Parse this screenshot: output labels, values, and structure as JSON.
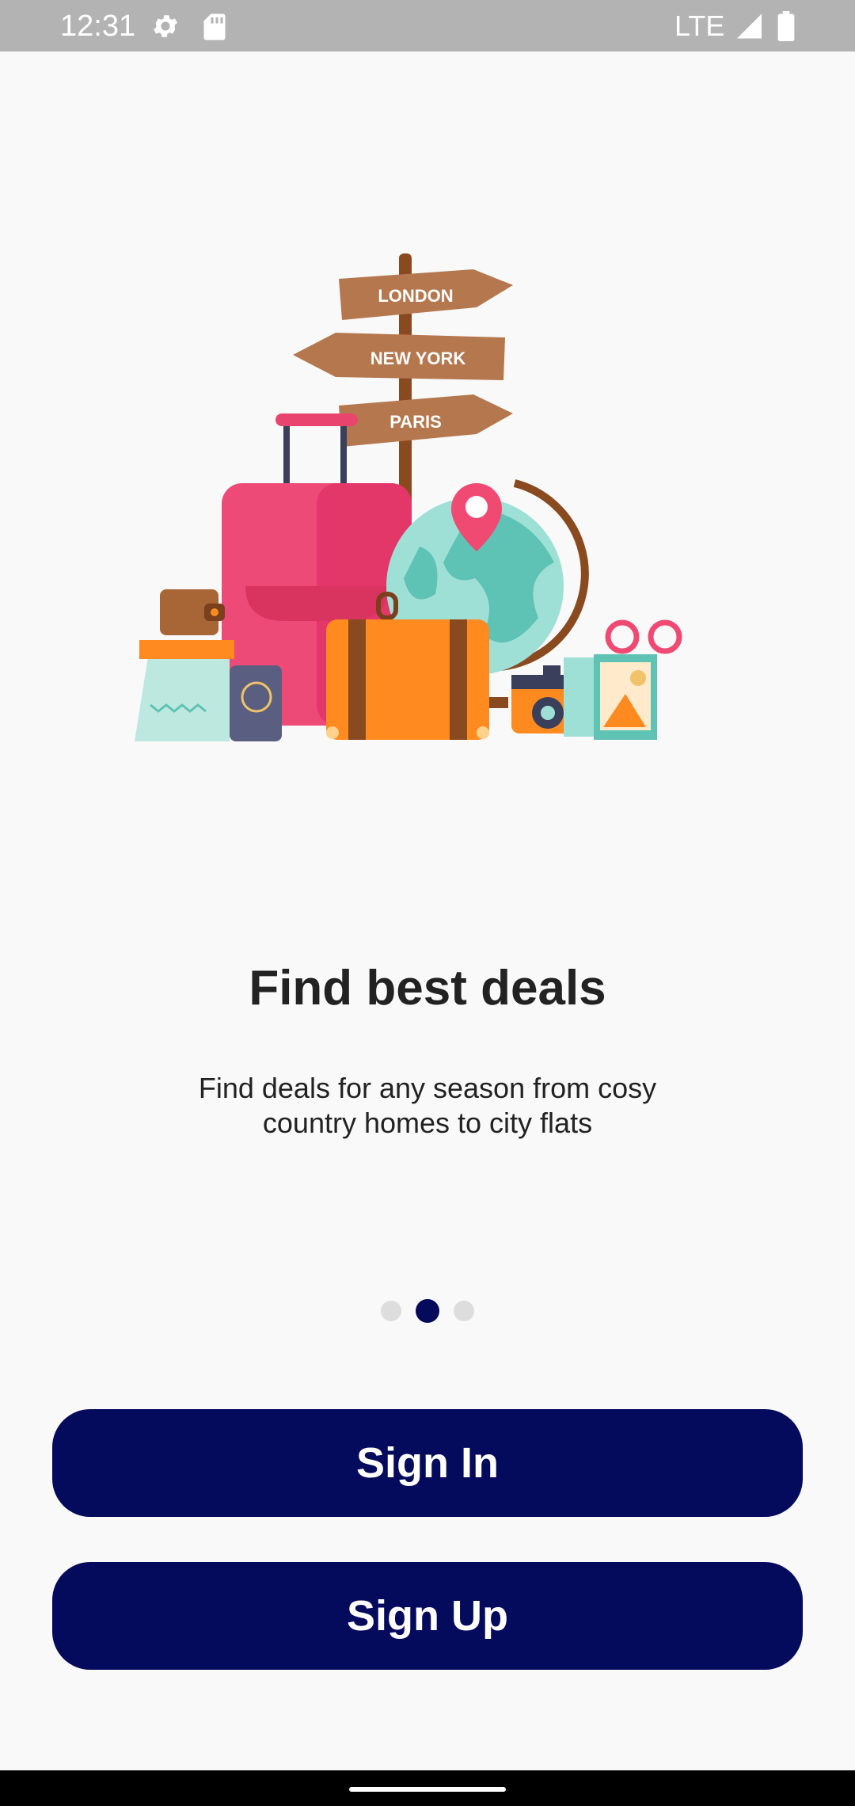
{
  "status_bar": {
    "time": "12:31",
    "network": "LTE",
    "icons": [
      "gear-icon",
      "sd-card-icon",
      "signal-icon",
      "battery-icon"
    ]
  },
  "hero": {
    "illustration": "travel-illustration",
    "signposts": [
      "LONDON",
      "NEW YORK",
      "PARIS"
    ]
  },
  "onboarding": {
    "title": "Find best deals",
    "description": "Find deals for any season from cosy country homes to city flats",
    "page_count": 3,
    "active_page": 2
  },
  "actions": {
    "sign_in": "Sign In",
    "sign_up": "Sign Up"
  },
  "colors": {
    "primary": "#040a5c",
    "background": "#f9f9f9",
    "status_bar": "#b3b3b3"
  }
}
